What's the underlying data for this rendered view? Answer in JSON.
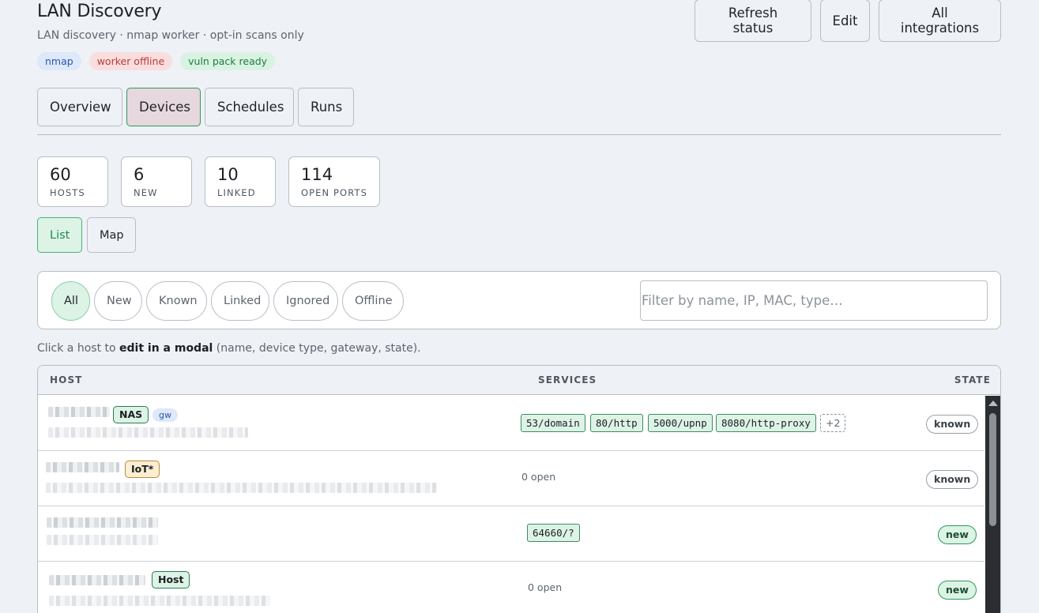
{
  "header": {
    "title": "LAN Discovery",
    "subtitle": "LAN discovery · nmap worker · opt-in scans only",
    "badges": [
      "nmap",
      "worker offline",
      "vuln pack ready"
    ],
    "actions": [
      "Refresh status",
      "Edit",
      "All integrations"
    ]
  },
  "tabs": [
    "Overview",
    "Devices",
    "Schedules",
    "Runs"
  ],
  "active_tab": "Devices",
  "stats": [
    {
      "value": "60",
      "label": "HOSTS"
    },
    {
      "value": "6",
      "label": "NEW"
    },
    {
      "value": "10",
      "label": "LINKED"
    },
    {
      "value": "114",
      "label": "OPEN PORTS"
    }
  ],
  "views": [
    "List",
    "Map"
  ],
  "active_view": "List",
  "filters": {
    "pills": [
      "All",
      "New",
      "Known",
      "Linked",
      "Ignored",
      "Offline"
    ],
    "active": "All",
    "search_placeholder": "Filter by name, IP, MAC, type…",
    "search_value": ""
  },
  "hint": {
    "before": "Click a host to ",
    "bold": "edit in a modal",
    "after": " (name, device type, gateway, state)."
  },
  "table": {
    "columns": [
      "HOST",
      "SERVICES",
      "STATE"
    ],
    "rows": [
      {
        "tags": [
          "NAS"
        ],
        "extra_badge": "gw",
        "services": [
          "53/domain",
          "80/http",
          "5000/upnp",
          "8080/http-proxy"
        ],
        "more": "+2",
        "open_text": "",
        "state": "known"
      },
      {
        "tags": [
          "IoT*"
        ],
        "extra_badge": "",
        "services": [],
        "more": "",
        "open_text": "0 open",
        "state": "known"
      },
      {
        "tags": [],
        "extra_badge": "",
        "services": [
          "64660/?"
        ],
        "more": "",
        "open_text": "",
        "state": "new"
      },
      {
        "tags": [
          "Host"
        ],
        "extra_badge": "",
        "services": [],
        "more": "",
        "open_text": "0 open",
        "state": "new"
      }
    ]
  }
}
